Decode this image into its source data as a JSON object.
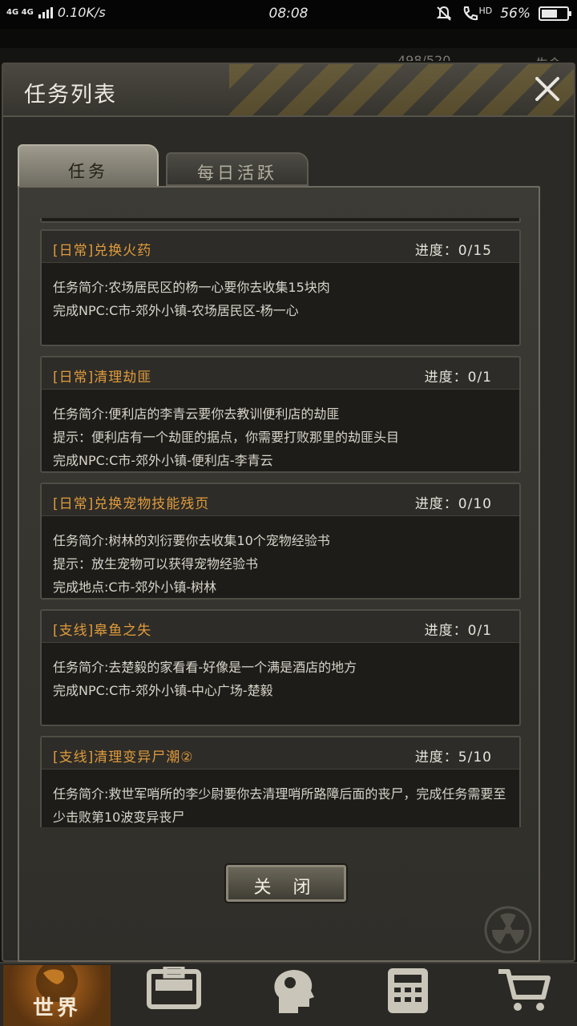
{
  "status_bar": {
    "network": "4G 4G",
    "speed": "0.10K/s",
    "time": "08:08",
    "hd_label": "HD",
    "battery": "56%",
    "battery_level": 0.56
  },
  "background": {
    "hp": "498/520",
    "label": "生命"
  },
  "dialog": {
    "title": "任务列表",
    "close_icon": "close-x-icon",
    "tabs": [
      {
        "label": "任务",
        "active": true
      },
      {
        "label": "每日活跃",
        "active": false
      }
    ],
    "tasks": [
      {
        "title": "[日常]兑换火药",
        "progress": "进度：0/15",
        "lines": [
          "任务简介:农场居民区的杨一心要你去收集15块肉",
          "完成NPC:C市-郊外小镇-农场居民区-杨一心"
        ]
      },
      {
        "title": "[日常]清理劫匪",
        "progress": "进度：0/1",
        "lines": [
          "任务简介:便利店的李青云要你去教训便利店的劫匪",
          "提示：便利店有一个劫匪的据点，你需要打败那里的劫匪头目",
          "完成NPC:C市-郊外小镇-便利店-李青云"
        ]
      },
      {
        "title": "[日常]兑换宠物技能残页",
        "progress": "进度：0/10",
        "lines": [
          "任务简介:树林的刘衍要你去收集10个宠物经验书",
          "提示：放生宠物可以获得宠物经验书",
          "完成地点:C市-郊外小镇-树林"
        ]
      },
      {
        "title": "[支线]皋鱼之失",
        "progress": "进度：0/1",
        "lines": [
          "任务简介:去楚毅的家看看-好像是一个满是酒店的地方",
          "完成NPC:C市-郊外小镇-中心广场-楚毅"
        ]
      },
      {
        "title": "[支线]清理变异尸潮②",
        "progress": "进度：5/10",
        "lines": [
          "任务简介:救世军哨所的李少尉要你去清理哨所路障后面的丧尸，完成任务需要至少击败第10波变异丧尸"
        ]
      }
    ],
    "close_button": "关 闭"
  },
  "bottom_nav": {
    "world_label": "世界",
    "icons": [
      "backpack-icon",
      "character-head-icon",
      "phone-icon",
      "shop-cart-icon"
    ]
  }
}
